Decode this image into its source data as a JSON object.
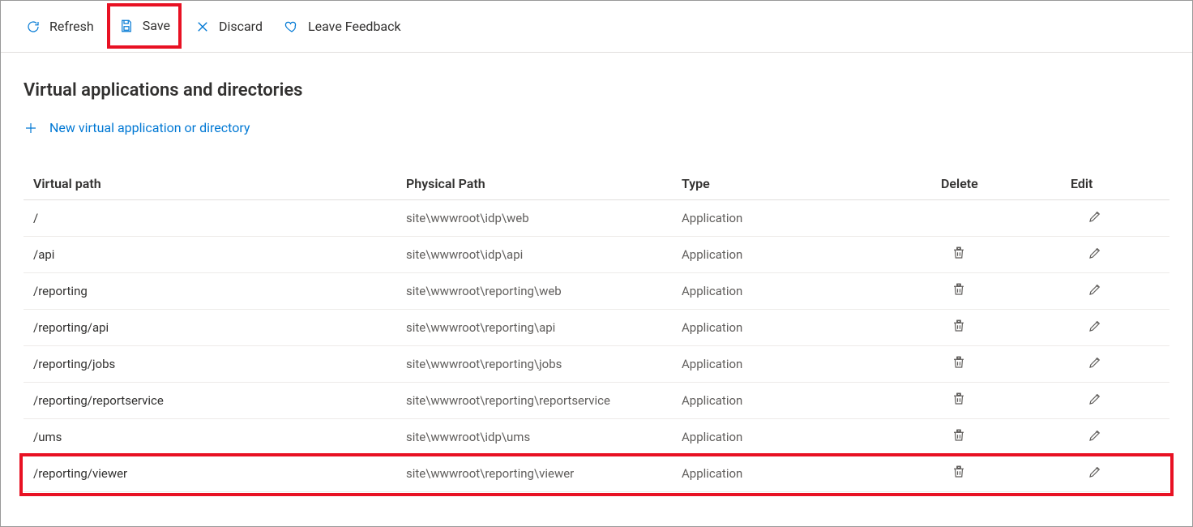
{
  "toolbar": {
    "refresh_label": "Refresh",
    "save_label": "Save",
    "discard_label": "Discard",
    "feedback_label": "Leave Feedback"
  },
  "page": {
    "title": "Virtual applications and directories",
    "add_label": "New virtual application or directory"
  },
  "columns": {
    "virtual_path": "Virtual path",
    "physical_path": "Physical Path",
    "type": "Type",
    "delete": "Delete",
    "edit": "Edit"
  },
  "rows": [
    {
      "vpath": "/",
      "ppath": "site\\wwwroot\\idp\\web",
      "type": "Application",
      "deletable": false
    },
    {
      "vpath": "/api",
      "ppath": "site\\wwwroot\\idp\\api",
      "type": "Application",
      "deletable": true
    },
    {
      "vpath": "/reporting",
      "ppath": "site\\wwwroot\\reporting\\web",
      "type": "Application",
      "deletable": true
    },
    {
      "vpath": "/reporting/api",
      "ppath": "site\\wwwroot\\reporting\\api",
      "type": "Application",
      "deletable": true
    },
    {
      "vpath": "/reporting/jobs",
      "ppath": "site\\wwwroot\\reporting\\jobs",
      "type": "Application",
      "deletable": true
    },
    {
      "vpath": "/reporting/reportservice",
      "ppath": "site\\wwwroot\\reporting\\reportservice",
      "type": "Application",
      "deletable": true
    },
    {
      "vpath": "/ums",
      "ppath": "site\\wwwroot\\idp\\ums",
      "type": "Application",
      "deletable": true
    },
    {
      "vpath": "/reporting/viewer",
      "ppath": "site\\wwwroot\\reporting\\viewer",
      "type": "Application",
      "deletable": true
    }
  ],
  "icons": {
    "refresh": "refresh-icon",
    "save": "save-icon",
    "discard": "close-icon",
    "feedback": "heart-icon",
    "plus": "plus-icon",
    "delete": "trash-icon",
    "edit": "pencil-icon"
  },
  "highlights": {
    "save_button": true,
    "last_row": true
  }
}
